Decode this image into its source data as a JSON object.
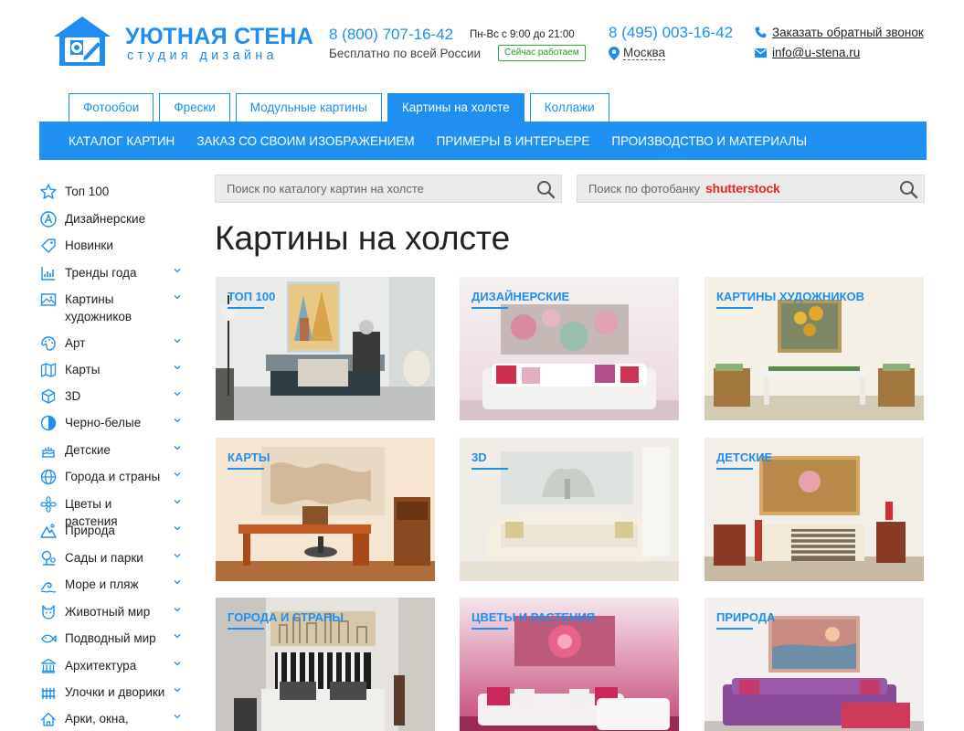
{
  "header": {
    "logo_title": "УЮТНАЯ СТЕНА",
    "logo_subtitle": "студия дизайна",
    "phone_free": "8 (800) 707-16-42",
    "phone_free_note": "Бесплатно по всей России",
    "hours": "Пн-Вс с 9:00 до 21:00",
    "open_badge": "Сейчас работаем",
    "phone_city": "8 (495) 003-16-42",
    "city": "Москва",
    "callback": "Заказать обратный звонок",
    "email": "info@u-stena.ru"
  },
  "tabs": [
    {
      "label": "Фотообои",
      "active": false
    },
    {
      "label": "Фрески",
      "active": false
    },
    {
      "label": "Модульные картины",
      "active": false
    },
    {
      "label": "Картины на холсте",
      "active": true
    },
    {
      "label": "Коллажи",
      "active": false
    }
  ],
  "nav": [
    "КАТАЛОГ КАРТИН",
    "ЗАКАЗ СО СВОИМ ИЗОБРАЖЕНИЕМ",
    "ПРИМЕРЫ В ИНТЕРЬЕРЕ",
    "ПРОИЗВОДСТВО И МАТЕРИАЛЫ"
  ],
  "search": {
    "catalog_placeholder": "Поиск по каталогу картин на холсте",
    "photobank_placeholder": "Поиск по фотобанку",
    "photobank_brand": "shutterstock"
  },
  "page_title": "Картины на холсте",
  "sidebar": [
    {
      "label": "Топ 100",
      "icon": "star-icon",
      "has_children": false
    },
    {
      "label": "Дизайнерские",
      "icon": "designer-a-icon",
      "has_children": false
    },
    {
      "label": "Новинки",
      "icon": "new-tag-icon",
      "has_children": false
    },
    {
      "label": "Тренды года",
      "icon": "trend-chart-icon",
      "has_children": true
    },
    {
      "label": "Картины художников",
      "icon": "picture-icon",
      "has_children": true
    },
    {
      "label": "Арт",
      "icon": "art-icon",
      "has_children": true
    },
    {
      "label": "Карты",
      "icon": "map-icon",
      "has_children": true
    },
    {
      "label": "3D",
      "icon": "cube-icon",
      "has_children": true
    },
    {
      "label": "Черно-белые",
      "icon": "black-white-icon",
      "has_children": true
    },
    {
      "label": "Детские",
      "icon": "cake-icon",
      "has_children": true
    },
    {
      "label": "Города и страны",
      "icon": "globe-icon",
      "has_children": true
    },
    {
      "label": "Цветы и растения",
      "icon": "flower-icon",
      "has_children": true
    },
    {
      "label": "Природа",
      "icon": "mountain-icon",
      "has_children": true
    },
    {
      "label": "Сады и парки",
      "icon": "tree-icon",
      "has_children": true
    },
    {
      "label": "Море и пляж",
      "icon": "wave-icon",
      "has_children": true
    },
    {
      "label": "Животный мир",
      "icon": "cat-icon",
      "has_children": true
    },
    {
      "label": "Подводный мир",
      "icon": "fish-icon",
      "has_children": true
    },
    {
      "label": "Архитектура",
      "icon": "building-icon",
      "has_children": true
    },
    {
      "label": "Улочки и дворики",
      "icon": "fence-icon",
      "has_children": true
    },
    {
      "label": "Арки, окна,",
      "icon": "arch-icon",
      "has_children": true
    }
  ],
  "categories": [
    {
      "label": "ТОП 100"
    },
    {
      "label": "ДИЗАЙНЕРСКИЕ"
    },
    {
      "label": "КАРТИНЫ ХУДОЖНИКОВ"
    },
    {
      "label": "КАРТЫ"
    },
    {
      "label": "3D"
    },
    {
      "label": "ДЕТСКИЕ"
    },
    {
      "label": "ГОРОДА И СТРАНЫ"
    },
    {
      "label": "ЦВЕТЫ И РАСТЕНИЯ"
    },
    {
      "label": "ПРИРОДА"
    }
  ],
  "colors": {
    "accent": "#1e8ef0",
    "nav_bg": "#2090f2",
    "open_badge": "#2a9a2a",
    "shutterstock": "#e62828"
  }
}
